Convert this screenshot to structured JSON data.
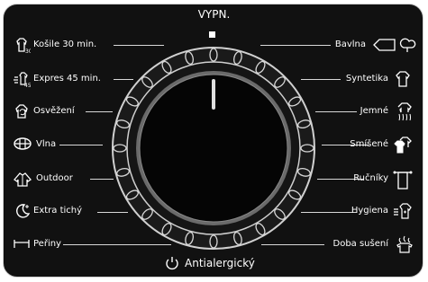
{
  "panel": {
    "top_label": "VYPN.",
    "bottom_label": "Antialergický",
    "left_programs": [
      {
        "label": "Košile 30 min.",
        "icon": "shirt-30-icon"
      },
      {
        "label": "Expres 45 min.",
        "icon": "express-45-icon"
      },
      {
        "label": "Osvěžení",
        "icon": "refresh-shirt-icon"
      },
      {
        "label": "Vlna",
        "icon": "wool-icon"
      },
      {
        "label": "Outdoor",
        "icon": "outdoor-jacket-icon"
      },
      {
        "label": "Extra tichý",
        "icon": "moon-quiet-icon"
      },
      {
        "label": "Peřiny",
        "icon": "bed-duvet-icon"
      }
    ],
    "right_programs": [
      {
        "label": "Bavlna",
        "icon": "cotton-icon"
      },
      {
        "label": "Syntetika",
        "icon": "synthetic-shirt-icon"
      },
      {
        "label": "Jemné",
        "icon": "delicate-icon"
      },
      {
        "label": "Smíšené",
        "icon": "mixed-icon"
      },
      {
        "label": "Ručníky",
        "icon": "towel-icon"
      },
      {
        "label": "Hygiena",
        "icon": "hygiene-icon"
      },
      {
        "label": "Doba sušení",
        "icon": "drying-time-icon"
      }
    ],
    "colors": {
      "background": "#111111",
      "text": "#ffffff",
      "accent": "#d8d8d8"
    }
  }
}
